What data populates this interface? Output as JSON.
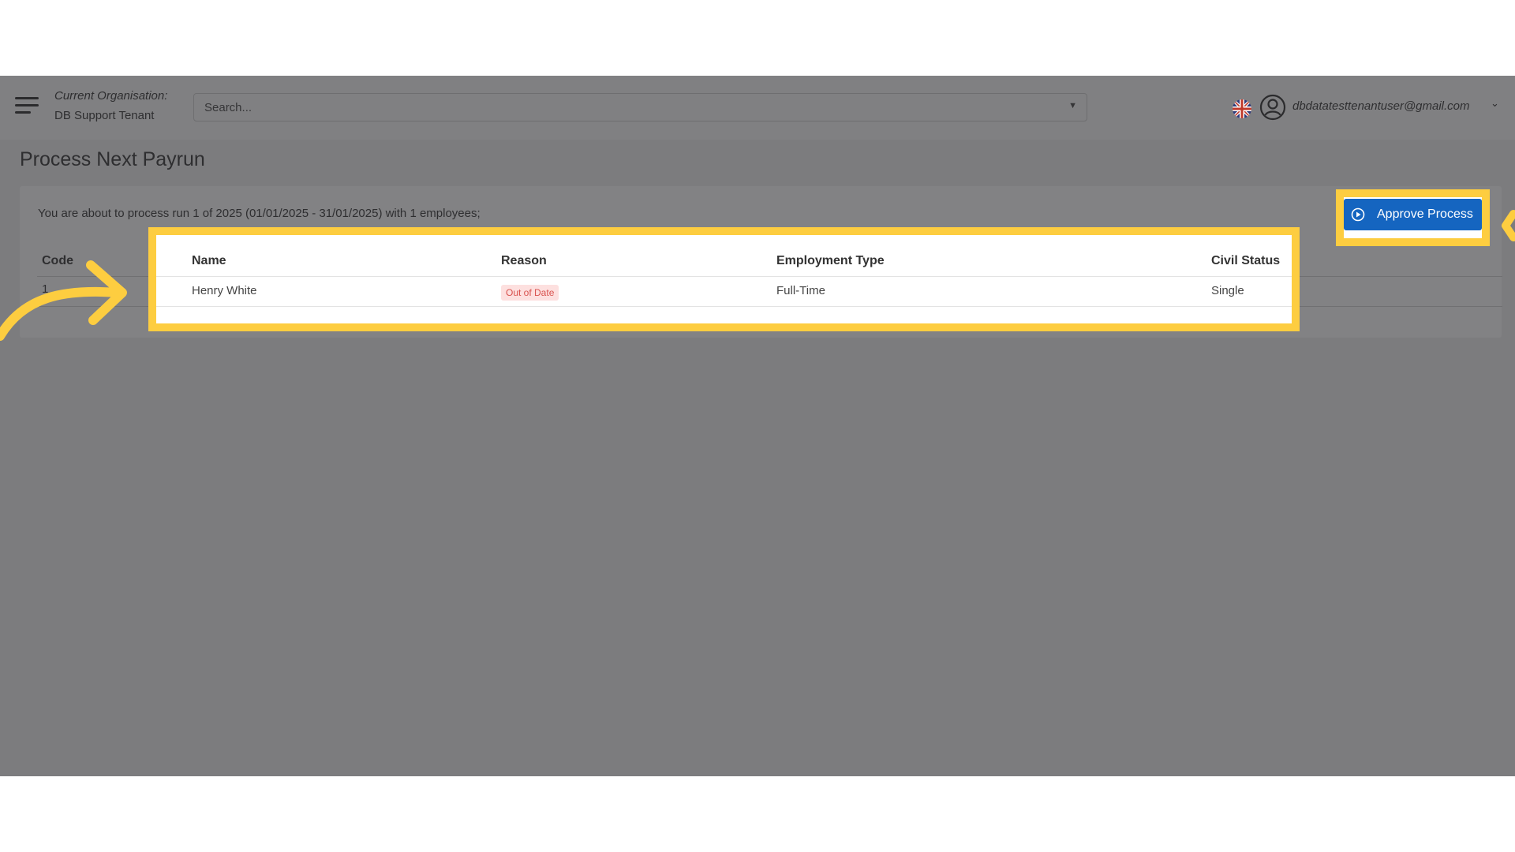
{
  "header": {
    "org_label": "Current Organisation:",
    "org_name": "DB Support Tenant",
    "search_placeholder": "Search...",
    "user_email": "dbdatatesttenantuser@gmail.com"
  },
  "page": {
    "title": "Process Next Payrun",
    "intro": "You are about to process run 1 of 2025 (01/01/2025 - 31/01/2025) with 1 employees;"
  },
  "table": {
    "columns": {
      "code": "Code",
      "name": "Name",
      "reason": "Reason",
      "employment_type": "Employment Type",
      "civil_status": "Civil Status"
    },
    "rows": [
      {
        "code": "1",
        "name": "Henry White",
        "reason": "Out of Date",
        "employment_type": "Full-Time",
        "civil_status": "Single"
      }
    ]
  },
  "actions": {
    "approve_label": "Approve Process"
  },
  "icons": {
    "menu": "hamburger-menu-icon",
    "flag": "uk-flag-icon",
    "avatar": "user-avatar-icon",
    "approve": "play-circle-icon"
  },
  "colors": {
    "highlight": "#fdcd40",
    "primary_button": "#1565c0",
    "badge_bg": "#fde0df",
    "badge_text": "#d9534f"
  }
}
